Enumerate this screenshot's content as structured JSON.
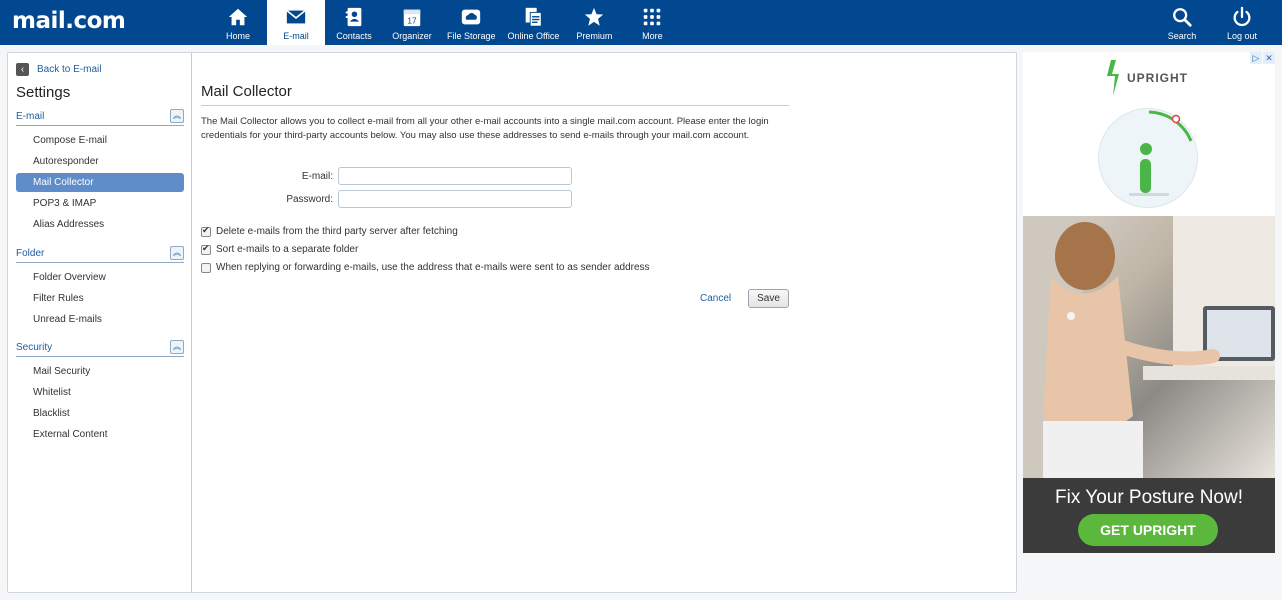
{
  "brand": {
    "logo_text": "mail.com"
  },
  "nav": {
    "items": [
      {
        "label": "Home",
        "icon": "home-icon"
      },
      {
        "label": "E-mail",
        "icon": "mail-icon"
      },
      {
        "label": "Contacts",
        "icon": "contacts-icon"
      },
      {
        "label": "Organizer",
        "icon": "calendar-icon"
      },
      {
        "label": "File Storage",
        "icon": "cloud-icon"
      },
      {
        "label": "Online Office",
        "icon": "document-icon"
      },
      {
        "label": "Premium",
        "icon": "star-icon"
      },
      {
        "label": "More",
        "icon": "grid-icon"
      }
    ],
    "active": "E-mail",
    "right": [
      {
        "label": "Search",
        "icon": "search-icon"
      },
      {
        "label": "Log out",
        "icon": "power-icon"
      }
    ]
  },
  "sidebar": {
    "back_label": "Back to E-mail",
    "title": "Settings",
    "sections": [
      {
        "heading": "E-mail",
        "items": [
          "Compose E-mail",
          "Autoresponder",
          "Mail Collector",
          "POP3 & IMAP",
          "Alias Addresses"
        ]
      },
      {
        "heading": "Folder",
        "items": [
          "Folder Overview",
          "Filter Rules",
          "Unread E-mails"
        ]
      },
      {
        "heading": "Security",
        "items": [
          "Mail Security",
          "Whitelist",
          "Blacklist",
          "External Content"
        ]
      }
    ],
    "active_item": "Mail Collector",
    "collapse_glyph": "︽"
  },
  "main": {
    "title": "Mail Collector",
    "description": "The Mail Collector allows you to collect e-mail from all your other e-mail accounts into a single mail.com account. Please enter the login credentials for your third-party accounts below. You may also use these addresses to send e-mails through your mail.com account.",
    "email_label": "E-mail:",
    "email_value": "",
    "password_label": "Password:",
    "password_value": "",
    "options": [
      {
        "label": "Delete e-mails from the third party server after fetching",
        "checked": true
      },
      {
        "label": "Sort e-mails to a separate folder",
        "checked": true
      },
      {
        "label": "When replying or forwarding e-mails, use the address that e-mails were sent to as sender address",
        "checked": false
      }
    ],
    "cancel_label": "Cancel",
    "save_label": "Save"
  },
  "ad": {
    "brand": "UPRIGHT",
    "headline": "Fix Your Posture Now!",
    "cta": "GET UPRIGHT",
    "choices": [
      "▷",
      "✕"
    ]
  },
  "colors": {
    "topbar": "#014890",
    "active_sidebar": "#5f8dc9",
    "link": "#1f5c9e",
    "cta": "#5cb83c"
  }
}
